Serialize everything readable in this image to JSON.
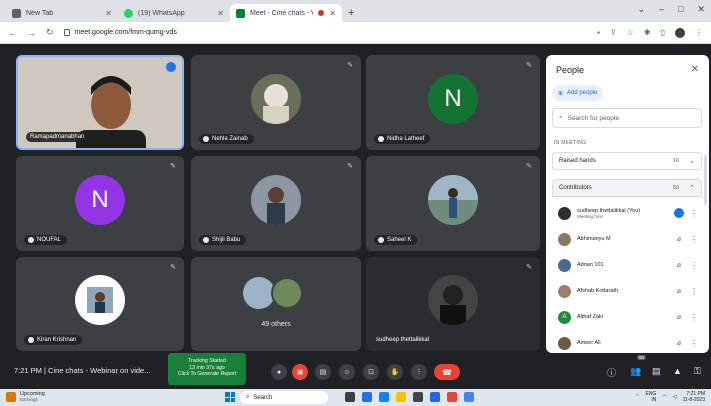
{
  "browser": {
    "tabs": [
      {
        "title": "New Tab",
        "active": false
      },
      {
        "title": "(19) WhatsApp",
        "active": false
      },
      {
        "title": "Meet - Cine chats - Webina",
        "active": true
      }
    ],
    "url": "meet.google.com/fmm-qumg-vds"
  },
  "tiles": [
    {
      "name": "Ramapadmanabhan"
    },
    {
      "name": "Nehla Zainab"
    },
    {
      "name": "Nidha Latheef",
      "letter": "N",
      "color": "#137333"
    },
    {
      "name": "NOUFAL",
      "letter": "N",
      "color": "#9334e6"
    },
    {
      "name": "Shijil Babu"
    },
    {
      "name": "Saheel K"
    },
    {
      "name": "Kiran Krishnan"
    },
    {
      "others": "49 others"
    },
    {
      "name": "sudheep thettalikkal"
    }
  ],
  "people_panel": {
    "title": "People",
    "add_people": "Add people",
    "search_placeholder": "Search for people",
    "section": "IN MEETING",
    "raised_hands": {
      "label": "Raised hands",
      "count": "16"
    },
    "contributors": {
      "label": "Contributors",
      "count": "59"
    },
    "people": [
      {
        "name": "sudheep thettalikkal (You)",
        "sub": "Meeting host"
      },
      {
        "name": "Abhimanyu M"
      },
      {
        "name": "Adnan 101"
      },
      {
        "name": "Afshab Kottarath"
      },
      {
        "name": "Althaf Zaki",
        "letter": "A"
      },
      {
        "name": "Ameer Ali"
      }
    ]
  },
  "meeting": {
    "time_title": "7:21 PM  |  Cine chats - Webinar on vide...",
    "participants_badge": "60"
  },
  "tracking": {
    "line1": "Tracking Started",
    "line2": "13 min 37s ago",
    "line3": "Click To Generate Report"
  },
  "taskbar": {
    "upcoming_title": "Upcoming",
    "upcoming_sub": "Earnings",
    "search": "Search",
    "lang1": "ENG",
    "lang2": "IN",
    "time": "7:21 PM",
    "date": "11-8-2023"
  }
}
